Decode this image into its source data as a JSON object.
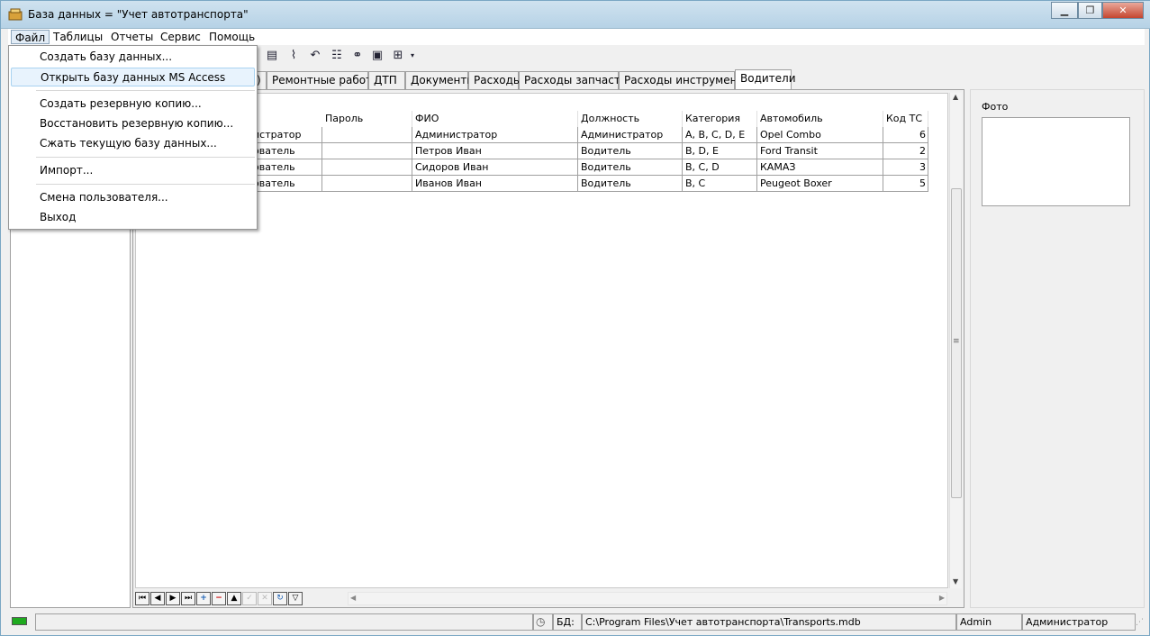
{
  "window": {
    "title": "База данных = \"Учет автотранспорта\""
  },
  "menubar": {
    "items": [
      "Файл",
      "Таблицы",
      "Отчеты",
      "Сервис",
      "Помощь"
    ]
  },
  "file_menu": {
    "items": [
      {
        "label": "Создать базу данных..."
      },
      {
        "label": "Открыть базу данных MS Access"
      },
      {
        "label": "Создать резервную копию..."
      },
      {
        "label": "Восстановить резервную копию..."
      },
      {
        "label": "Сжать текущую базу данных..."
      },
      {
        "label": "Импорт..."
      },
      {
        "label": "Смена пользователя..."
      },
      {
        "label": "Выход"
      }
    ]
  },
  "tabs": [
    {
      "label": ")"
    },
    {
      "label": "Ремонтные работы"
    },
    {
      "label": "ДТП"
    },
    {
      "label": "Документы"
    },
    {
      "label": "Расходы"
    },
    {
      "label": "Расходы запчастей"
    },
    {
      "label": "Расходы инструментов"
    },
    {
      "label": "Водители"
    }
  ],
  "grid": {
    "columns": [
      "Пароль",
      "ФИО",
      "Должность",
      "Категория",
      "Автомобиль",
      "Код ТС"
    ],
    "rows": [
      {
        "role": "истратор",
        "password": "",
        "name": "Администратор",
        "position": "Администратор",
        "category": "A, B, C, D, E",
        "car": "Opel Combo",
        "code": "6"
      },
      {
        "role": "ователь",
        "password": "",
        "name": "Петров Иван",
        "position": "Водитель",
        "category": "B, D, E",
        "car": "Ford Transit",
        "code": "2"
      },
      {
        "role": "ователь",
        "password": "",
        "name": "Сидоров Иван",
        "position": "Водитель",
        "category": "B, C, D",
        "car": "КАМАЗ",
        "code": "3"
      },
      {
        "role": "ователь",
        "password": "",
        "name": "Иванов Иван",
        "position": "Водитель",
        "category": "B, C",
        "car": "Peugeot Boxer",
        "code": "5"
      }
    ]
  },
  "photo": {
    "label": "Фото"
  },
  "statusbar": {
    "db_label": "БД:",
    "db_path": "C:\\Program Files\\Учет автотранспорта\\Transports.mdb",
    "user": "Admin",
    "role": "Администратор"
  },
  "colors": {
    "titlebar": "#c4dbeb",
    "selection_highlight": "#e8f3fd",
    "status_indicator": "#1faa1f"
  }
}
